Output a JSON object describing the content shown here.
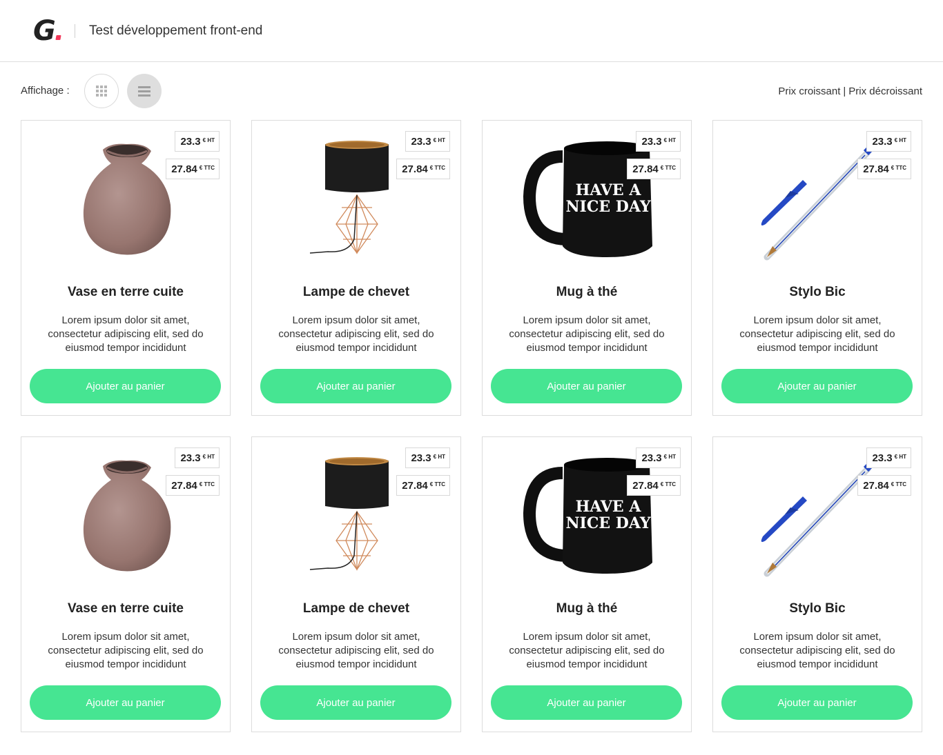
{
  "header": {
    "logo_letter": "G",
    "title": "Test développement front-end"
  },
  "toolbar": {
    "display_label": "Affichage :",
    "grid_view_icon": "grid-icon",
    "list_view_icon": "list-icon",
    "sort_asc": "Prix croissant",
    "sort_sep": "|",
    "sort_desc": "Prix décroissant"
  },
  "colors": {
    "accent_button": "#46e592",
    "logo_dot": "#f2385a"
  },
  "products": [
    {
      "name": "Vase en terre cuite",
      "image": "vase",
      "price_ht": "23.3",
      "unit_ht": "€ HT",
      "price_ttc": "27.84",
      "unit_ttc": "€ TTC",
      "description": "Lorem ipsum dolor sit amet, consectetur adipiscing elit, sed do eiusmod tempor incididunt",
      "button": "Ajouter au panier"
    },
    {
      "name": "Lampe de chevet",
      "image": "lamp",
      "price_ht": "23.3",
      "unit_ht": "€ HT",
      "price_ttc": "27.84",
      "unit_ttc": "€ TTC",
      "description": "Lorem ipsum dolor sit amet, consectetur adipiscing elit, sed do eiusmod tempor incididunt",
      "button": "Ajouter au panier"
    },
    {
      "name": "Mug à thé",
      "image": "mug",
      "mug_text_1": "HAVE A",
      "mug_text_2": "NICE DAY",
      "price_ht": "23.3",
      "unit_ht": "€ HT",
      "price_ttc": "27.84",
      "unit_ttc": "€ TTC",
      "description": "Lorem ipsum dolor sit amet, consectetur adipiscing elit, sed do eiusmod tempor incididunt",
      "button": "Ajouter au panier"
    },
    {
      "name": "Stylo Bic",
      "image": "pen",
      "price_ht": "23.3",
      "unit_ht": "€ HT",
      "price_ttc": "27.84",
      "unit_ttc": "€ TTC",
      "description": "Lorem ipsum dolor sit amet, consectetur adipiscing elit, sed do eiusmod tempor incididunt",
      "button": "Ajouter au panier"
    },
    {
      "name": "Vase en terre cuite",
      "image": "vase",
      "price_ht": "23.3",
      "unit_ht": "€ HT",
      "price_ttc": "27.84",
      "unit_ttc": "€ TTC",
      "description": "Lorem ipsum dolor sit amet, consectetur adipiscing elit, sed do eiusmod tempor incididunt",
      "button": "Ajouter au panier"
    },
    {
      "name": "Lampe de chevet",
      "image": "lamp",
      "price_ht": "23.3",
      "unit_ht": "€ HT",
      "price_ttc": "27.84",
      "unit_ttc": "€ TTC",
      "description": "Lorem ipsum dolor sit amet, consectetur adipiscing elit, sed do eiusmod tempor incididunt",
      "button": "Ajouter au panier"
    },
    {
      "name": "Mug à thé",
      "image": "mug",
      "mug_text_1": "HAVE A",
      "mug_text_2": "NICE DAY",
      "price_ht": "23.3",
      "unit_ht": "€ HT",
      "price_ttc": "27.84",
      "unit_ttc": "€ TTC",
      "description": "Lorem ipsum dolor sit amet, consectetur adipiscing elit, sed do eiusmod tempor incididunt",
      "button": "Ajouter au panier"
    },
    {
      "name": "Stylo Bic",
      "image": "pen",
      "price_ht": "23.3",
      "unit_ht": "€ HT",
      "price_ttc": "27.84",
      "unit_ttc": "€ TTC",
      "description": "Lorem ipsum dolor sit amet, consectetur adipiscing elit, sed do eiusmod tempor incididunt",
      "button": "Ajouter au panier"
    }
  ]
}
